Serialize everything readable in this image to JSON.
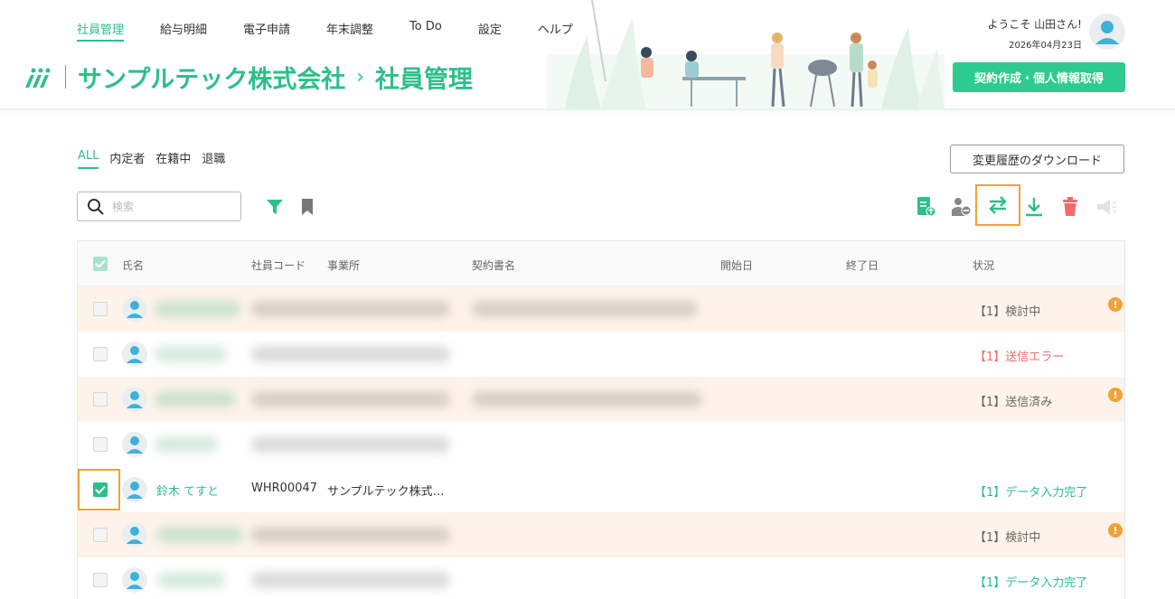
{
  "nav": {
    "items": [
      "社員管理",
      "給与明細",
      "電子申請",
      "年末調整",
      "To Do",
      "設定",
      "ヘルプ"
    ],
    "active_index": 0
  },
  "header": {
    "company": "サンプルテック株式会社",
    "separator": "›",
    "page": "社員管理",
    "welcome": "ようこそ 山田さん!",
    "date": "2026年04月23日",
    "contract_button": "契約作成・個人情報取得"
  },
  "tabs": {
    "items": [
      "ALL",
      "内定者",
      "在籍中",
      "退職"
    ],
    "active_index": 0
  },
  "history_button": "変更履歴のダウンロード",
  "search": {
    "placeholder": "検索",
    "icon": "search-icon"
  },
  "toolbar": {
    "icons": [
      "filter-icon",
      "bookmark-icon",
      "document-upload-icon",
      "user-remove-icon",
      "swap-arrows-icon",
      "download-icon",
      "trash-icon",
      "megaphone-icon"
    ],
    "highlighted": "swap-arrows-icon"
  },
  "table": {
    "headers": {
      "name": "氏名",
      "code": "社員コード",
      "office": "事業所",
      "contract": "契約書名",
      "start": "開始日",
      "end": "終了日",
      "status": "状況"
    },
    "rows": [
      {
        "checked": false,
        "name": "",
        "code": "",
        "office": "",
        "status": "【1】検討中",
        "status_color": "gray",
        "warning": true,
        "alt": true
      },
      {
        "checked": false,
        "name": "",
        "code": "",
        "office": "",
        "status": "【1】送信エラー",
        "status_color": "red",
        "warning": false,
        "alt": false
      },
      {
        "checked": false,
        "name": "",
        "code": "",
        "office": "",
        "status": "【1】送信済み",
        "status_color": "gray",
        "warning": true,
        "alt": true
      },
      {
        "checked": false,
        "name": "",
        "code": "",
        "office": "",
        "status": "",
        "status_color": "gray",
        "warning": false,
        "alt": false
      },
      {
        "checked": true,
        "name": "鈴木 てすと",
        "code": "WHR00047",
        "office": "サンプルテック株式…",
        "status": "【1】データ入力完了",
        "status_color": "green",
        "warning": false,
        "alt": false
      },
      {
        "checked": false,
        "name": "",
        "code": "",
        "office": "",
        "status": "【1】検討中",
        "status_color": "gray",
        "warning": true,
        "alt": true
      },
      {
        "checked": false,
        "name": "",
        "code": "",
        "office": "",
        "status": "【1】データ入力完了",
        "status_color": "green",
        "warning": false,
        "alt": false
      }
    ]
  },
  "colors": {
    "accent": "#2dbf8a",
    "button_green": "#2dcb8f",
    "highlight_orange": "#f0a23a",
    "row_alt": "#fdf3ea",
    "error_red": "#f06b6b",
    "trash_red": "#f06b6b"
  }
}
